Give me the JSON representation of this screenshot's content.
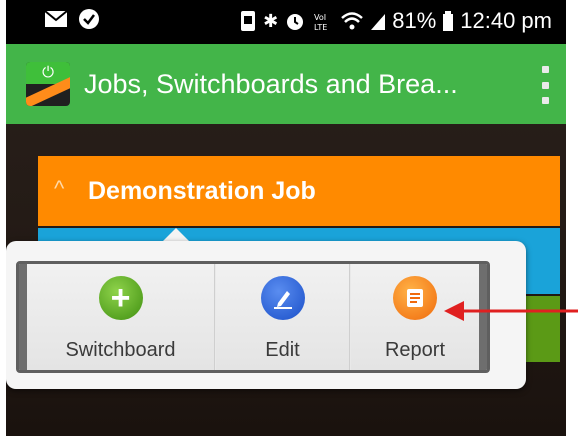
{
  "status_bar": {
    "battery_percent": "81%",
    "time": "12:40 pm",
    "left_icons": [
      "mail-icon",
      "check-circle-icon"
    ],
    "right_icons": [
      "screenshot-icon",
      "bluetooth-icon",
      "alarm-icon",
      "volte-icon",
      "wifi-icon",
      "signal-icon",
      "battery-icon"
    ]
  },
  "app_bar": {
    "title": "Jobs, Switchboards and Brea...",
    "logo_icon": "app-logo-icon",
    "menu_icon": "overflow-menu-icon",
    "color": "#43b549"
  },
  "job": {
    "title": "Demonstration Job",
    "chevron": "^",
    "header_color": "#ff8a00",
    "row_colors": [
      "#1aa3d9",
      "#5b9a16"
    ]
  },
  "popup": {
    "actions": [
      {
        "label": "Switchboard",
        "icon": "add-icon",
        "color": "#3f8f10"
      },
      {
        "label": "Edit",
        "icon": "edit-icon",
        "color": "#1a4fc8"
      },
      {
        "label": "Report",
        "icon": "report-icon",
        "color": "#f06a0c"
      }
    ]
  },
  "annotation": {
    "arrow_color": "#e02020"
  }
}
